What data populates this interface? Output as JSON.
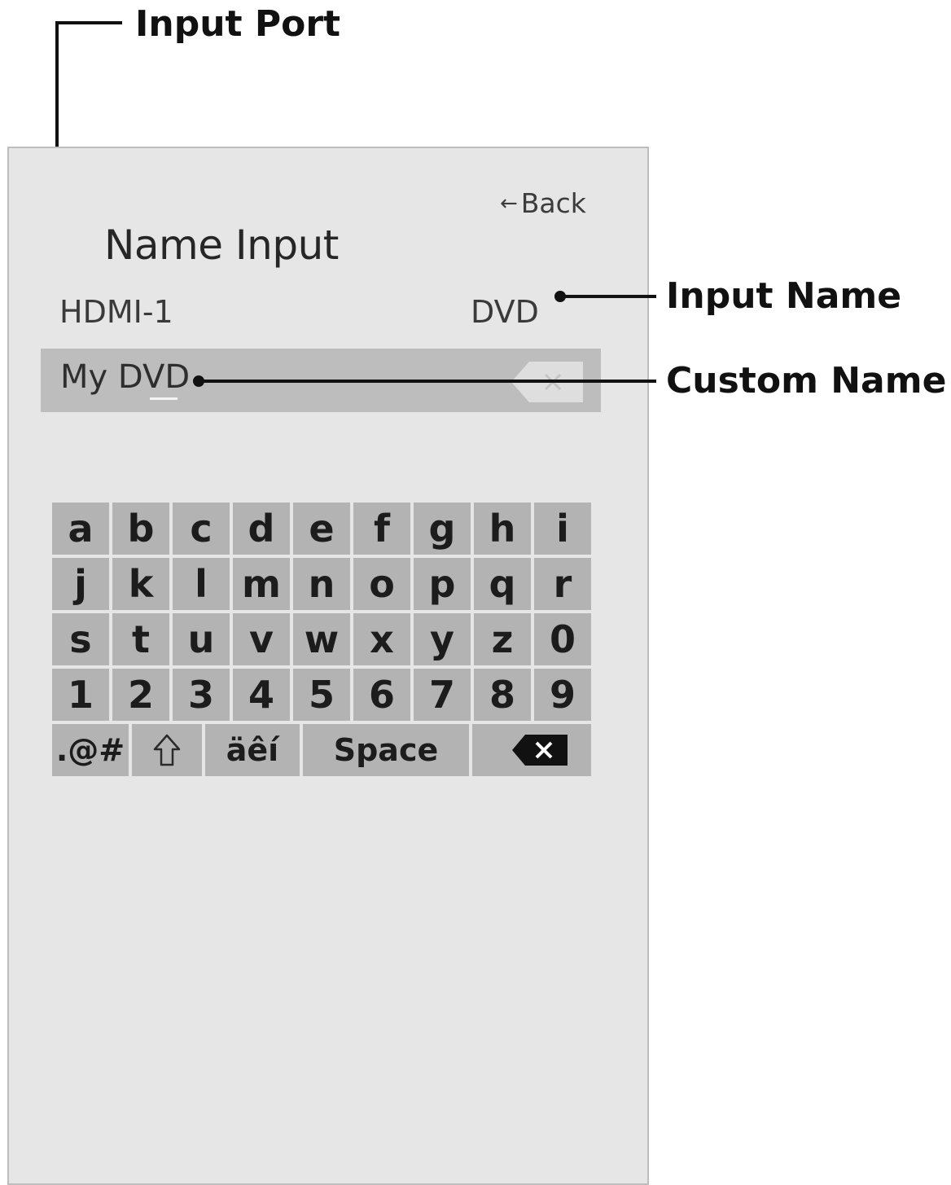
{
  "callouts": {
    "input_port": "Input Port",
    "input_name": "Input Name",
    "custom_name": "Custom Name"
  },
  "screen": {
    "back_label": "Back",
    "title": "Name Input",
    "port": "HDMI-1",
    "input_name": "DVD",
    "custom_name_value": "My DVD"
  },
  "keyboard": {
    "rows": [
      [
        "a",
        "b",
        "c",
        "d",
        "e",
        "f",
        "g",
        "h",
        "i"
      ],
      [
        "j",
        "k",
        "l",
        "m",
        "n",
        "o",
        "p",
        "q",
        "r"
      ],
      [
        "s",
        "t",
        "u",
        "v",
        "w",
        "x",
        "y",
        "z",
        "0"
      ],
      [
        "1",
        "2",
        "3",
        "4",
        "5",
        "6",
        "7",
        "8",
        "9"
      ]
    ],
    "symbols_key": ".@#",
    "accents_key": "äêí",
    "space_key": "Space"
  },
  "icons": {
    "back": "left-arrow-icon",
    "clear": "clear-field-icon",
    "shift": "shift-arrow-icon",
    "backspace": "backspace-icon"
  },
  "colors": {
    "panel": "#e6e6e6",
    "field": "#bdbdbd",
    "key": "#b3b3b3",
    "callout": "#111111"
  }
}
